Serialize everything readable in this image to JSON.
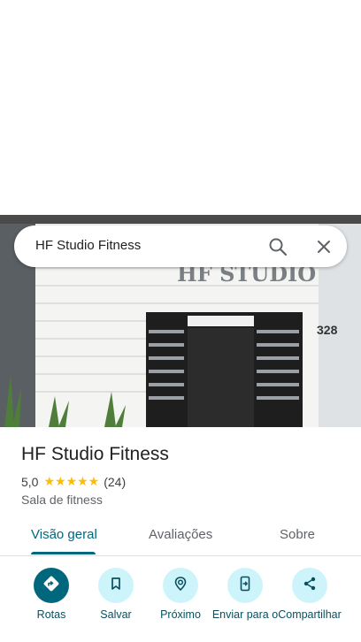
{
  "search": {
    "query": "HF Studio Fitness"
  },
  "photo": {
    "sign_text": "HF STUDIO",
    "number": "328"
  },
  "place": {
    "title": "HF Studio Fitness",
    "rating": "5,0",
    "stars": "★★★★★",
    "reviews": "(24)",
    "category": "Sala de fitness"
  },
  "tabs": [
    "Visão geral",
    "Avaliações",
    "Sobre"
  ],
  "actions": [
    {
      "label": "Rotas",
      "icon": "directions-icon"
    },
    {
      "label": "Salvar",
      "icon": "bookmark-icon"
    },
    {
      "label": "Próximo",
      "icon": "nearby-icon"
    },
    {
      "label": "Enviar para o",
      "icon": "send-to-phone-icon"
    },
    {
      "label": "Compartilhar",
      "icon": "share-icon"
    }
  ],
  "colors": {
    "accent": "#00677d",
    "chip": "#cdf4fb",
    "star": "#fbbc04"
  }
}
